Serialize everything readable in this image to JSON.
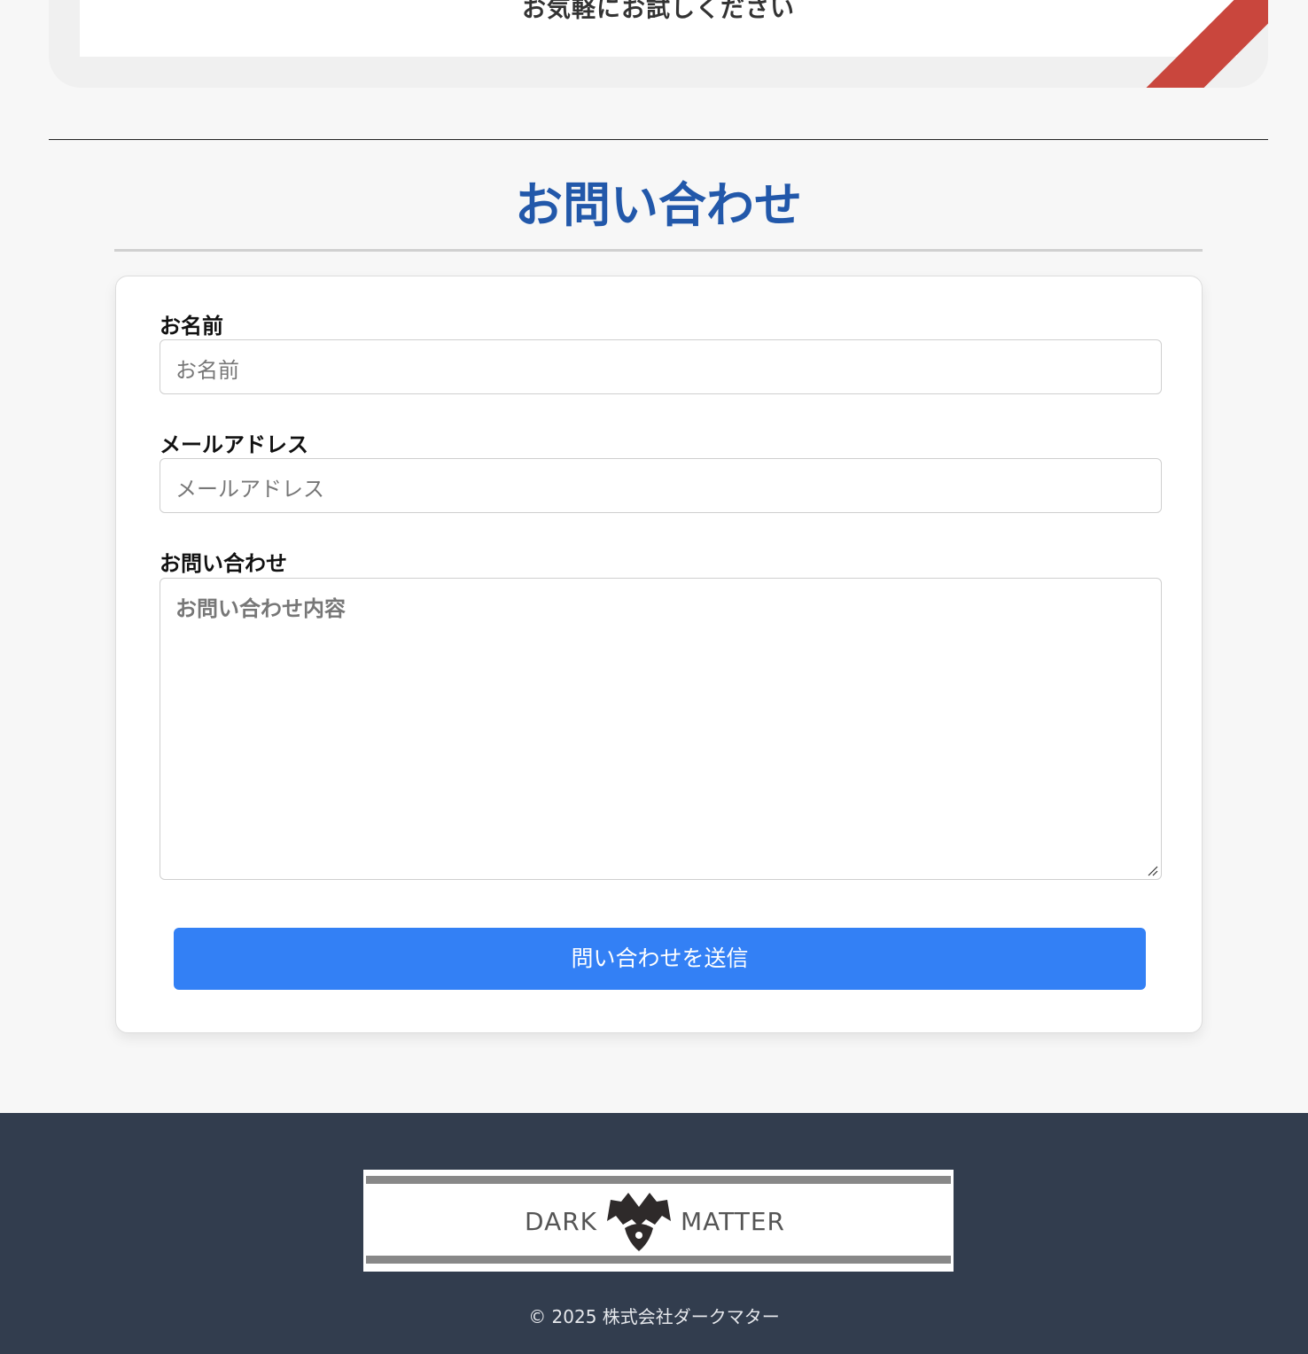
{
  "promo": {
    "text": "お気軽にお試しください"
  },
  "contact": {
    "title": "お問い合わせ",
    "fields": {
      "name": {
        "label": "お名前",
        "placeholder": "お名前"
      },
      "email": {
        "label": "メールアドレス",
        "placeholder": "メールアドレス"
      },
      "message": {
        "label": "お問い合わせ",
        "placeholder": "お問い合わせ内容"
      }
    },
    "submit_label": "問い合わせを送信"
  },
  "footer": {
    "logo": {
      "left_text": "DARK",
      "right_text": "MATTER"
    },
    "copyright": "© 2025 株式会社ダークマター"
  },
  "colors": {
    "title": "#2258aa",
    "button": "#3380f5",
    "footer_bg": "#323d4e",
    "ribbon": "#c9463d"
  },
  "icons": {
    "resize_handle": "resize-handle-icon",
    "logo_mark": "dark-matter-logo-icon"
  }
}
